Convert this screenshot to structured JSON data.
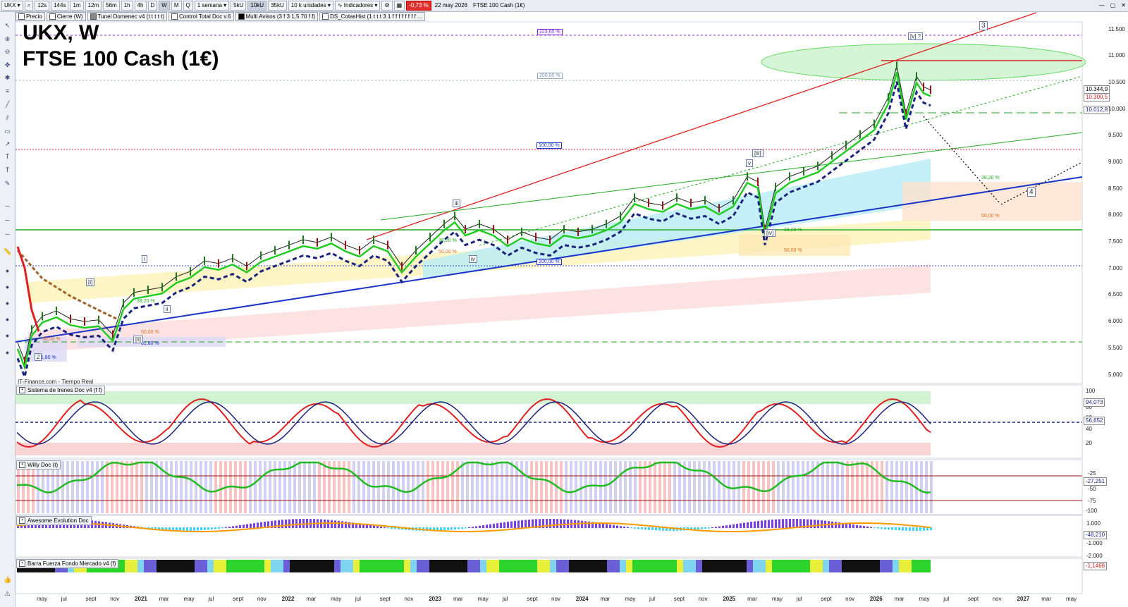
{
  "toolbar": {
    "symbol": "UKX",
    "timeframes": [
      "12s",
      "144s",
      "1m",
      "12m",
      "56m",
      "1h",
      "4h",
      "D",
      "W",
      "M",
      "Q"
    ],
    "selected_tf": "W",
    "period": "1 semana",
    "units": [
      "5kU",
      "10kU",
      "35kU"
    ],
    "selected_unit": "10kU",
    "units_select": "10 k unidades",
    "indicators_label": "Indicadores",
    "change": "-0,73 %",
    "date": "22 may 2026",
    "instrument": "FTSE 100 Cash (1€)"
  },
  "indicator_bar": [
    "Precio",
    "Cierre (W)",
    "Tunel Domenec v4 (t t t t t)",
    "Control Total Doc v.6",
    "Multi Avisos (3 f 3 1,5 70 f f)",
    "DS_CotasHist (1 t t t 3 1 f f f f f f f f ..."
  ],
  "chart": {
    "title_line1": "UKX, W",
    "title_line2": "FTSE 100 Cash (1€)",
    "credit": "IT-Finance.com - Tiempo Real",
    "price_axis": [
      "11.500",
      "11.000",
      "10.500",
      "10.000",
      "9.500",
      "9.000",
      "8.500",
      "8.000",
      "7.500",
      "7.000",
      "6.500",
      "6.000",
      "5.500",
      "5.000"
    ],
    "price_labels": [
      {
        "text": "10.344,9",
        "color": "#000000"
      },
      {
        "text": "10.300,5",
        "color": "#d02020"
      },
      {
        "text": "10.012,8",
        "color": "#1a237e"
      }
    ],
    "fib_labels": [
      "223,60 %",
      "200,00 %",
      "100,00 %",
      "100,00 %",
      "38,20 %",
      "50,00 %",
      "38,20 %",
      "50,00 %",
      "38,20 %",
      "50,00 %",
      "38,20 %",
      "50,00 %",
      "61,80 %",
      "61,80 %",
      "50,00 %"
    ],
    "wave_labels": [
      "[i]",
      "i",
      "ii",
      "[ii]",
      "iii",
      "iv",
      "[iii]",
      "v",
      "[iv]",
      "[v] ?",
      "3",
      "4",
      "2",
      "iii"
    ]
  },
  "panels": [
    {
      "title": "Sistema de trenes Doc v4 (f f)",
      "axis": [
        "100",
        "80",
        "60",
        "40",
        "20"
      ],
      "values": [
        "94,073",
        "56,652"
      ]
    },
    {
      "title": "Willy Doc (t)",
      "axis": [
        "-25",
        "-50",
        "-75",
        "-100"
      ],
      "values": [
        "-27,251"
      ]
    },
    {
      "title": "Awesome Evolution Doc",
      "axis": [
        "1.000",
        "-1.000"
      ],
      "values": [
        "-48,210"
      ]
    },
    {
      "title": "Barra Fuerza Fondo Mercado v4 (f)",
      "axis": [
        "-2.000"
      ],
      "values": [
        "-1,1468"
      ]
    }
  ],
  "time_axis": [
    "may",
    "jul",
    "sept",
    "nov",
    "2021",
    "mar",
    "may",
    "jul",
    "sept",
    "nov",
    "2022",
    "mar",
    "may",
    "jul",
    "sept",
    "nov",
    "2023",
    "mar",
    "may",
    "jul",
    "sept",
    "nov",
    "2024",
    "mar",
    "may",
    "jul",
    "sept",
    "nov",
    "2025",
    "mar",
    "may",
    "jul",
    "sept",
    "nov",
    "2026",
    "mar",
    "may",
    "jul",
    "sept",
    "nov",
    "2027",
    "mar",
    "may"
  ],
  "colors": {
    "up_trend": "#e02020",
    "support": "#1a33c8",
    "sma_green": "#22cc22",
    "dashed_blue": "#1a237e"
  }
}
